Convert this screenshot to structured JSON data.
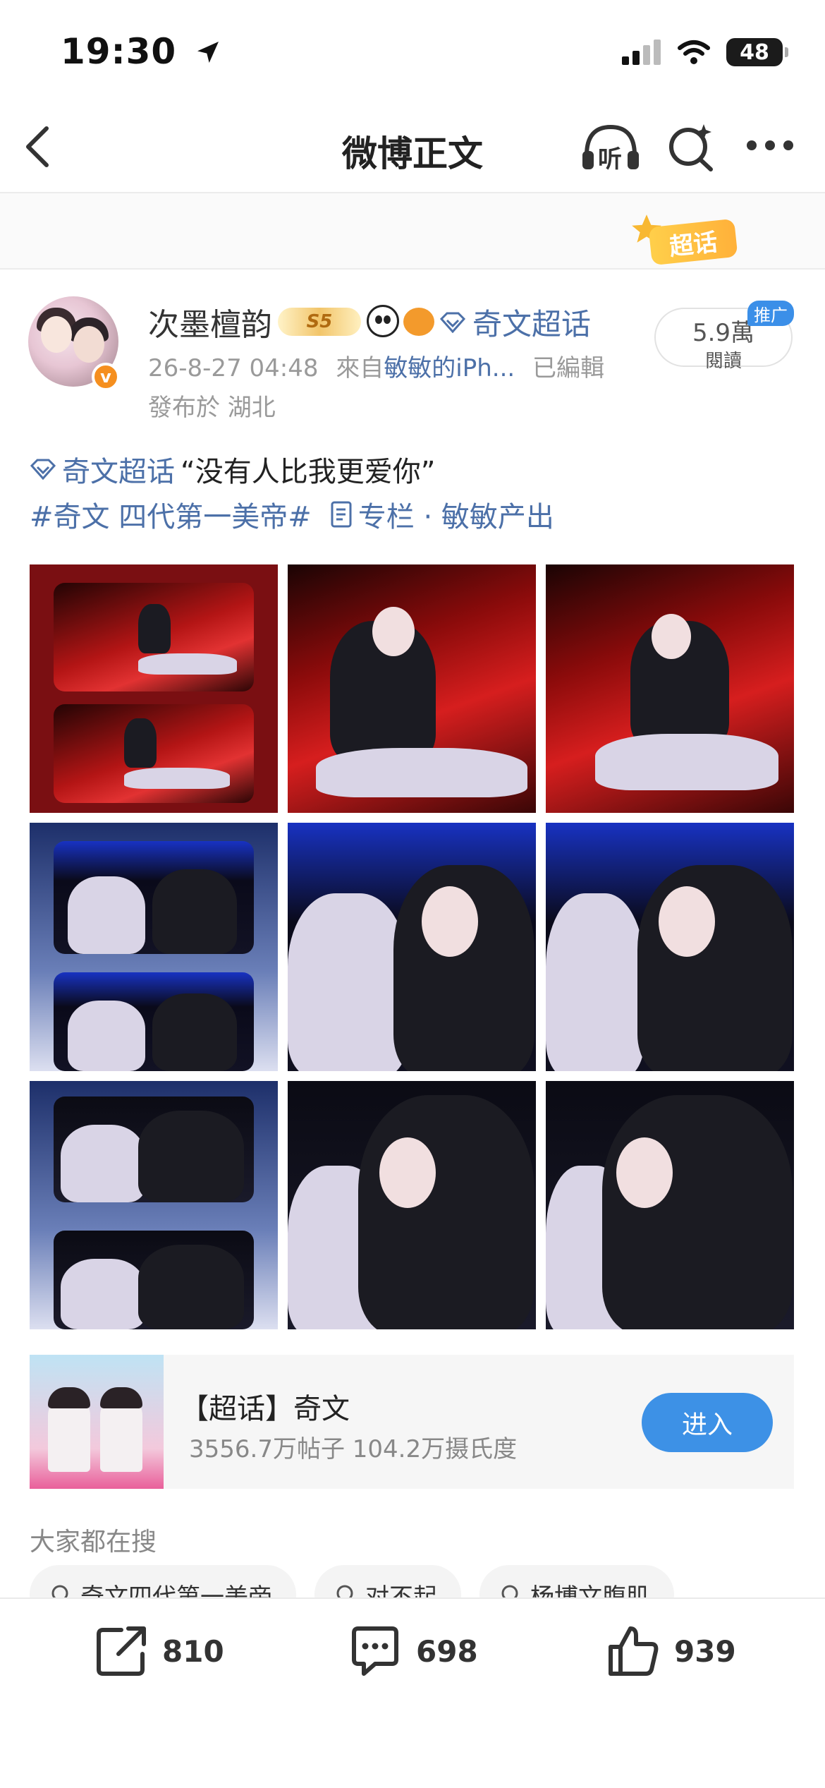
{
  "status_bar": {
    "time": "19:30",
    "battery": "48"
  },
  "nav": {
    "title": "微博正文",
    "listen_label": "听"
  },
  "super_topic_badge": "超话",
  "post": {
    "author": "次墨檀韵",
    "level_badge": "S5",
    "topic_tag": "奇文超话",
    "timestamp": "26-8-27 04:48",
    "source_prefix": "來自",
    "source": "敏敏的iPh...",
    "edited": "已編輯",
    "location": "發布於 湖北",
    "reads": "5.9萬",
    "reads_label": "閱讀",
    "promo_tag": "推广",
    "body_topic": "奇文超话",
    "body_quote": "“没有人比我更爱你”",
    "hashtag": "#奇文 四代第一美帝#",
    "column_link": "专栏 · 敏敏产出"
  },
  "super_topic_card": {
    "title": "【超话】奇文",
    "stats": "3556.7万帖子 104.2万摄氏度",
    "enter_label": "进入"
  },
  "search": {
    "heading": "大家都在搜",
    "chips": [
      "奇文四代第一美帝",
      "对不起",
      "杨博文腹肌"
    ]
  },
  "actions": {
    "reposts": "810",
    "comments": "698",
    "likes": "939"
  },
  "colors": {
    "link": "#4c70a8",
    "accent": "#3d91e6",
    "verified": "#f58f1f"
  }
}
